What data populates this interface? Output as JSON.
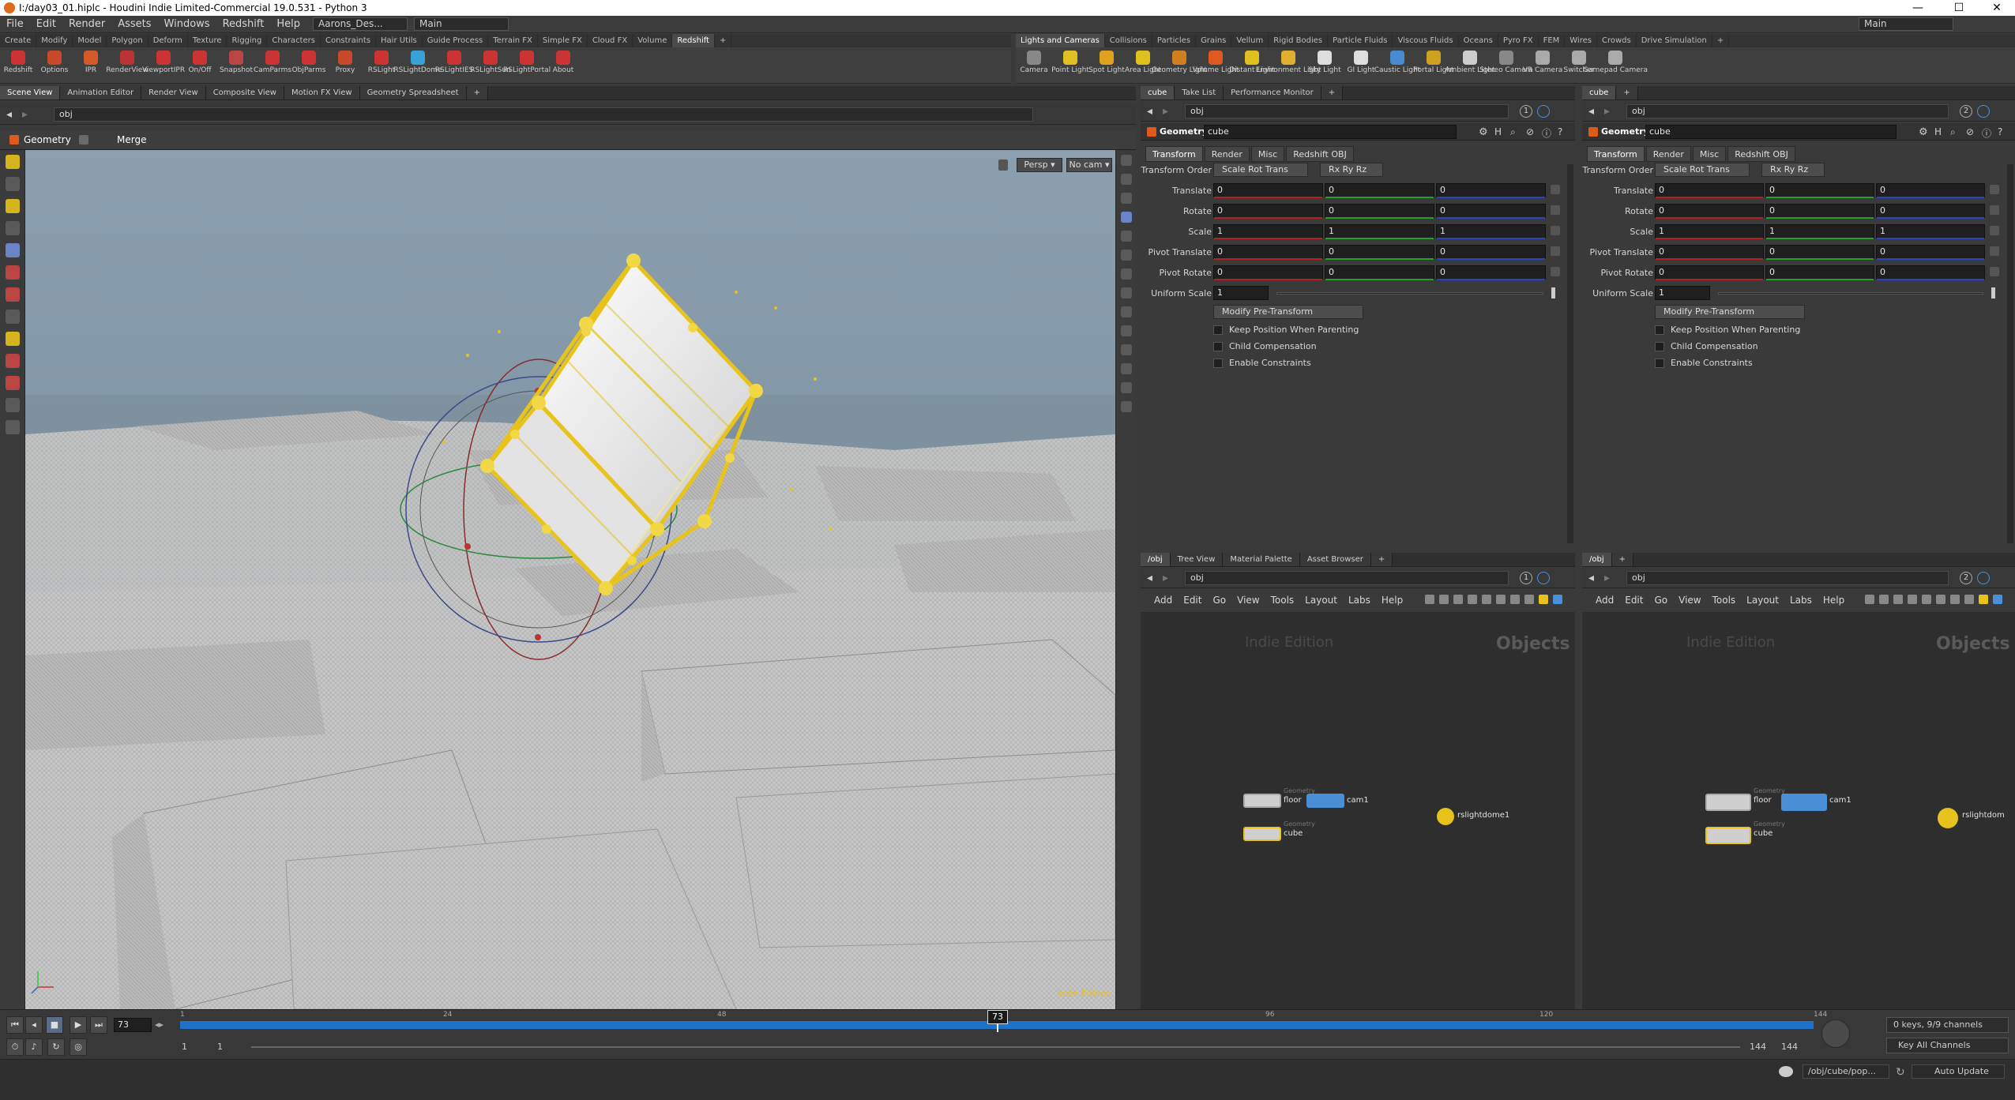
{
  "window": {
    "title": "I:/day03_01.hiplc - Houdini Indie Limited-Commercial 19.0.531 - Python 3",
    "controls": [
      "—",
      "☐",
      "✕"
    ]
  },
  "menu": {
    "items": [
      "File",
      "Edit",
      "Render",
      "Assets",
      "Windows",
      "Redshift",
      "Help"
    ],
    "desktop": "Aarons_Des...",
    "main_dd": "Main",
    "right_dd": "Main"
  },
  "shelf_left": {
    "tabs": [
      "Create",
      "Modify",
      "Model",
      "Polygon",
      "Deform",
      "Texture",
      "Rigging",
      "Characters",
      "Constraints",
      "Hair Utils",
      "Guide Process",
      "Terrain FX",
      "Simple FX",
      "Cloud FX",
      "Volume",
      "Redshift",
      "+"
    ],
    "active": "Redshift",
    "tools": [
      "Redshift",
      "Options",
      "IPR",
      "RenderView",
      "ViewportIPR",
      "On/Off",
      "Snapshot",
      "CamParms",
      "ObjParms",
      "Proxy",
      "RSLight",
      "RSLightDome",
      "RSLightIES",
      "RSLightSun",
      "RSLightPortal",
      "About"
    ]
  },
  "shelf_right": {
    "tabs": [
      "Lights and Cameras",
      "Collisions",
      "Particles",
      "Grains",
      "Vellum",
      "Rigid Bodies",
      "Particle Fluids",
      "Viscous Fluids",
      "Oceans",
      "Pyro FX",
      "FEM",
      "Wires",
      "Crowds",
      "Drive Simulation",
      "+"
    ],
    "active": "Lights and Cameras",
    "tools": [
      "Camera",
      "Point Light",
      "Spot Light",
      "Area Light",
      "Geometry Light",
      "Volume Light",
      "Distant Light",
      "Environment Light",
      "Sky Light",
      "GI Light",
      "Caustic Light",
      "Portal Light",
      "Ambient Light",
      "Stereo Camera",
      "VR Camera",
      "Switcher",
      "Gamepad Camera"
    ]
  },
  "scene_tabs": [
    "Scene View",
    "Animation Editor",
    "Render View",
    "Composite View",
    "Motion FX View",
    "Geometry Spreadsheet",
    "+"
  ],
  "scene_path": "obj",
  "viewport": {
    "context": "Geometry",
    "node": "Merge",
    "persp": "Persp ▾",
    "cam": "No cam ▾",
    "watermark": "Indie Edition"
  },
  "param_tabs_1": [
    "cube",
    "Take List",
    "Performance Monitor",
    "+"
  ],
  "param_tabs_2": [
    "cube",
    "+"
  ],
  "params": {
    "path": "obj",
    "path_num_1": "1",
    "path_num_2": "2",
    "node_type": "Geometry",
    "node_name": "cube",
    "tabs": [
      "Transform",
      "Render",
      "Misc",
      "Redshift OBJ"
    ],
    "transform_order_label": "Transform Order",
    "transform_order": "Scale Rot Trans",
    "rot_order": "Rx Ry Rz",
    "rows": [
      {
        "label": "Translate",
        "v": [
          "0",
          "0",
          "0"
        ]
      },
      {
        "label": "Rotate",
        "v": [
          "0",
          "0",
          "0"
        ]
      },
      {
        "label": "Scale",
        "v": [
          "1",
          "1",
          "1"
        ]
      },
      {
        "label": "Pivot Translate",
        "v": [
          "0",
          "0",
          "0"
        ]
      },
      {
        "label": "Pivot Rotate",
        "v": [
          "0",
          "0",
          "0"
        ]
      }
    ],
    "uniform_label": "Uniform Scale",
    "uniform": "1",
    "pretransform": "Modify Pre-Transform",
    "checks": [
      "Keep Position When Parenting",
      "Child Compensation",
      "Enable Constraints"
    ]
  },
  "net_tabs_1": [
    "/obj",
    "Tree View",
    "Material Palette",
    "Asset Browser",
    "+"
  ],
  "net_tabs_2": [
    "/obj",
    "+"
  ],
  "network": {
    "menu": [
      "Add",
      "Edit",
      "Go",
      "View",
      "Tools",
      "Layout",
      "Labs",
      "Help"
    ],
    "watermark": "Indie Edition",
    "context_label": "Objects",
    "nodes": {
      "floor": "floor",
      "cam": "cam1",
      "cube": "cube",
      "dome": "rslightdome1",
      "dome_cut": "rslightdom",
      "sub": "Geometry"
    }
  },
  "timeline": {
    "frame": "73",
    "ticks": [
      "1",
      "24",
      "48",
      "72",
      "96",
      "120",
      "144"
    ],
    "start": "1",
    "start2": "1",
    "end": "144",
    "end2": "144",
    "keys": "0 keys, 9/9 channels",
    "keyall": "Key All Channels",
    "path": "/obj/cube/pop...",
    "update": "Auto Update"
  },
  "colors": {
    "accent": "#ffd21a",
    "timeline_bar": "#1e73c8",
    "selection": "#e8c31c"
  }
}
